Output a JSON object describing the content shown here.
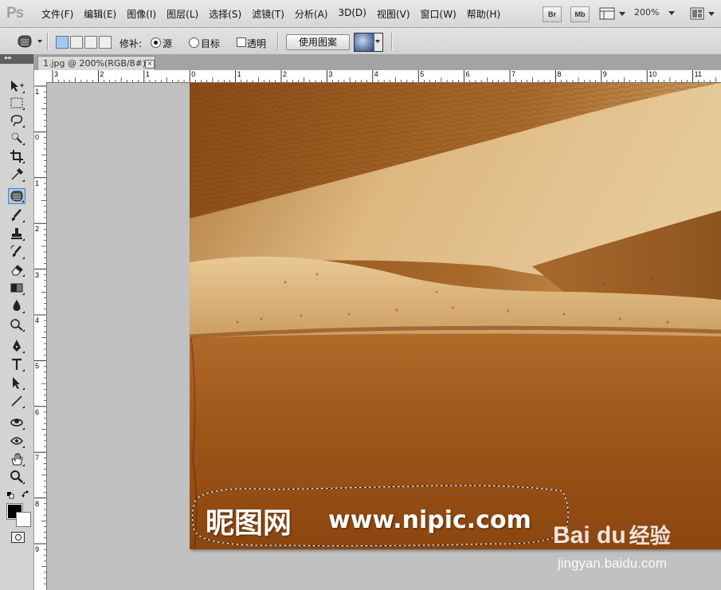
{
  "app": {
    "logo": "Ps"
  },
  "menu": {
    "items": [
      "文件(F)",
      "编辑(E)",
      "图像(I)",
      "图层(L)",
      "选择(S)",
      "滤镜(T)",
      "分析(A)",
      "3D(D)",
      "视图(V)",
      "窗口(W)",
      "帮助(H)"
    ],
    "bridge_label": "Br",
    "minibridge_label": "Mb",
    "zoom_level": "200%"
  },
  "options": {
    "patch_label": "修补:",
    "source_label": "源",
    "target_label": "目标",
    "transparent_label": "透明",
    "use_pattern_label": "使用图案",
    "source_selected": true,
    "target_selected": false,
    "transparent_checked": false
  },
  "document": {
    "tab_title": "1.jpg @ 200%(RGB/8#)",
    "close_label": "×"
  },
  "rulers": {
    "horizontal": [
      "3",
      "2",
      "1",
      "0",
      "1",
      "2",
      "3",
      "4",
      "5",
      "6",
      "7",
      "8",
      "9",
      "10",
      "11"
    ],
    "vertical": [
      "1",
      "0",
      "1",
      "2",
      "3",
      "4",
      "5",
      "6",
      "7",
      "8",
      "9"
    ]
  },
  "canvas": {
    "watermark_text": "昵图网",
    "watermark_url": "www.nipic.com",
    "baidu_logo": "Bai du",
    "baidu_jingyan": "经验",
    "baidu_url": "jingyan.baidu.com"
  },
  "tools": [
    "move-tool",
    "marquee-tool",
    "lasso-tool",
    "quick-select-tool",
    "crop-tool",
    "eyedropper-tool",
    "patch-tool",
    "brush-tool",
    "clone-stamp-tool",
    "history-brush-tool",
    "eraser-tool",
    "gradient-tool",
    "blur-tool",
    "dodge-tool",
    "pen-tool",
    "type-tool",
    "path-select-tool",
    "line-tool",
    "3d-rotate-tool",
    "3d-orbit-tool",
    "hand-tool",
    "zoom-tool"
  ],
  "colors": {
    "foreground": "#000000",
    "background": "#ffffff",
    "selection_accent": "#a8c6ea"
  }
}
